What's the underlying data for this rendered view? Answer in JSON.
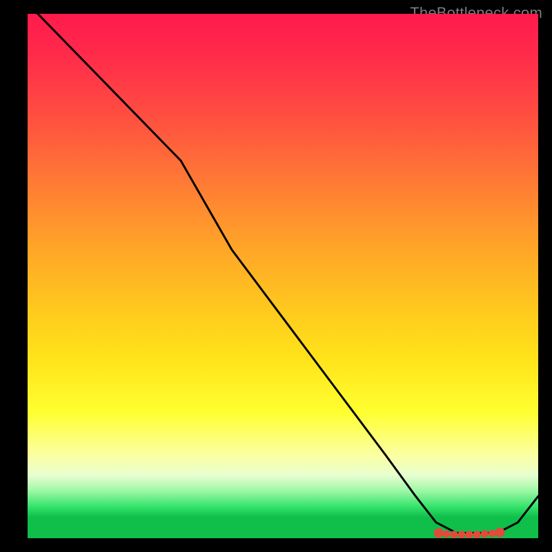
{
  "watermark": "TheBottleneck.com",
  "chart_data": {
    "type": "line",
    "title": "",
    "xlabel": "",
    "ylabel": "",
    "xlim": [
      0,
      100
    ],
    "ylim": [
      0,
      100
    ],
    "background_gradient": {
      "direction": "vertical",
      "meaning": "top=high bottleneck (red), bottom=optimal (green)",
      "stops": [
        {
          "pct": 0,
          "color": "#ff1a4d"
        },
        {
          "pct": 20,
          "color": "#ff5040"
        },
        {
          "pct": 44,
          "color": "#ffa328"
        },
        {
          "pct": 66,
          "color": "#ffe41a"
        },
        {
          "pct": 84,
          "color": "#fbffa0"
        },
        {
          "pct": 94,
          "color": "#34e36a"
        },
        {
          "pct": 96,
          "color": "#0fbf4a"
        }
      ]
    },
    "series": [
      {
        "name": "bottleneck-curve",
        "color": "#000000",
        "x": [
          0,
          10,
          20,
          30,
          40,
          50,
          60,
          70,
          76,
          80,
          84,
          88,
          92,
          96,
          100
        ],
        "values": [
          102,
          92,
          82,
          72,
          55,
          42,
          29,
          16,
          8,
          3,
          1,
          1,
          1,
          3,
          8
        ]
      }
    ],
    "markers": {
      "name": "optimal-range-dots",
      "shape": "circle",
      "color": "#e24a3b",
      "x": [
        80.5,
        82,
        83.5,
        85,
        86.5,
        88,
        89.5,
        91,
        92.5
      ],
      "y": [
        1.0,
        0.8,
        0.7,
        0.7,
        0.7,
        0.7,
        0.8,
        0.9,
        1.1
      ]
    }
  }
}
